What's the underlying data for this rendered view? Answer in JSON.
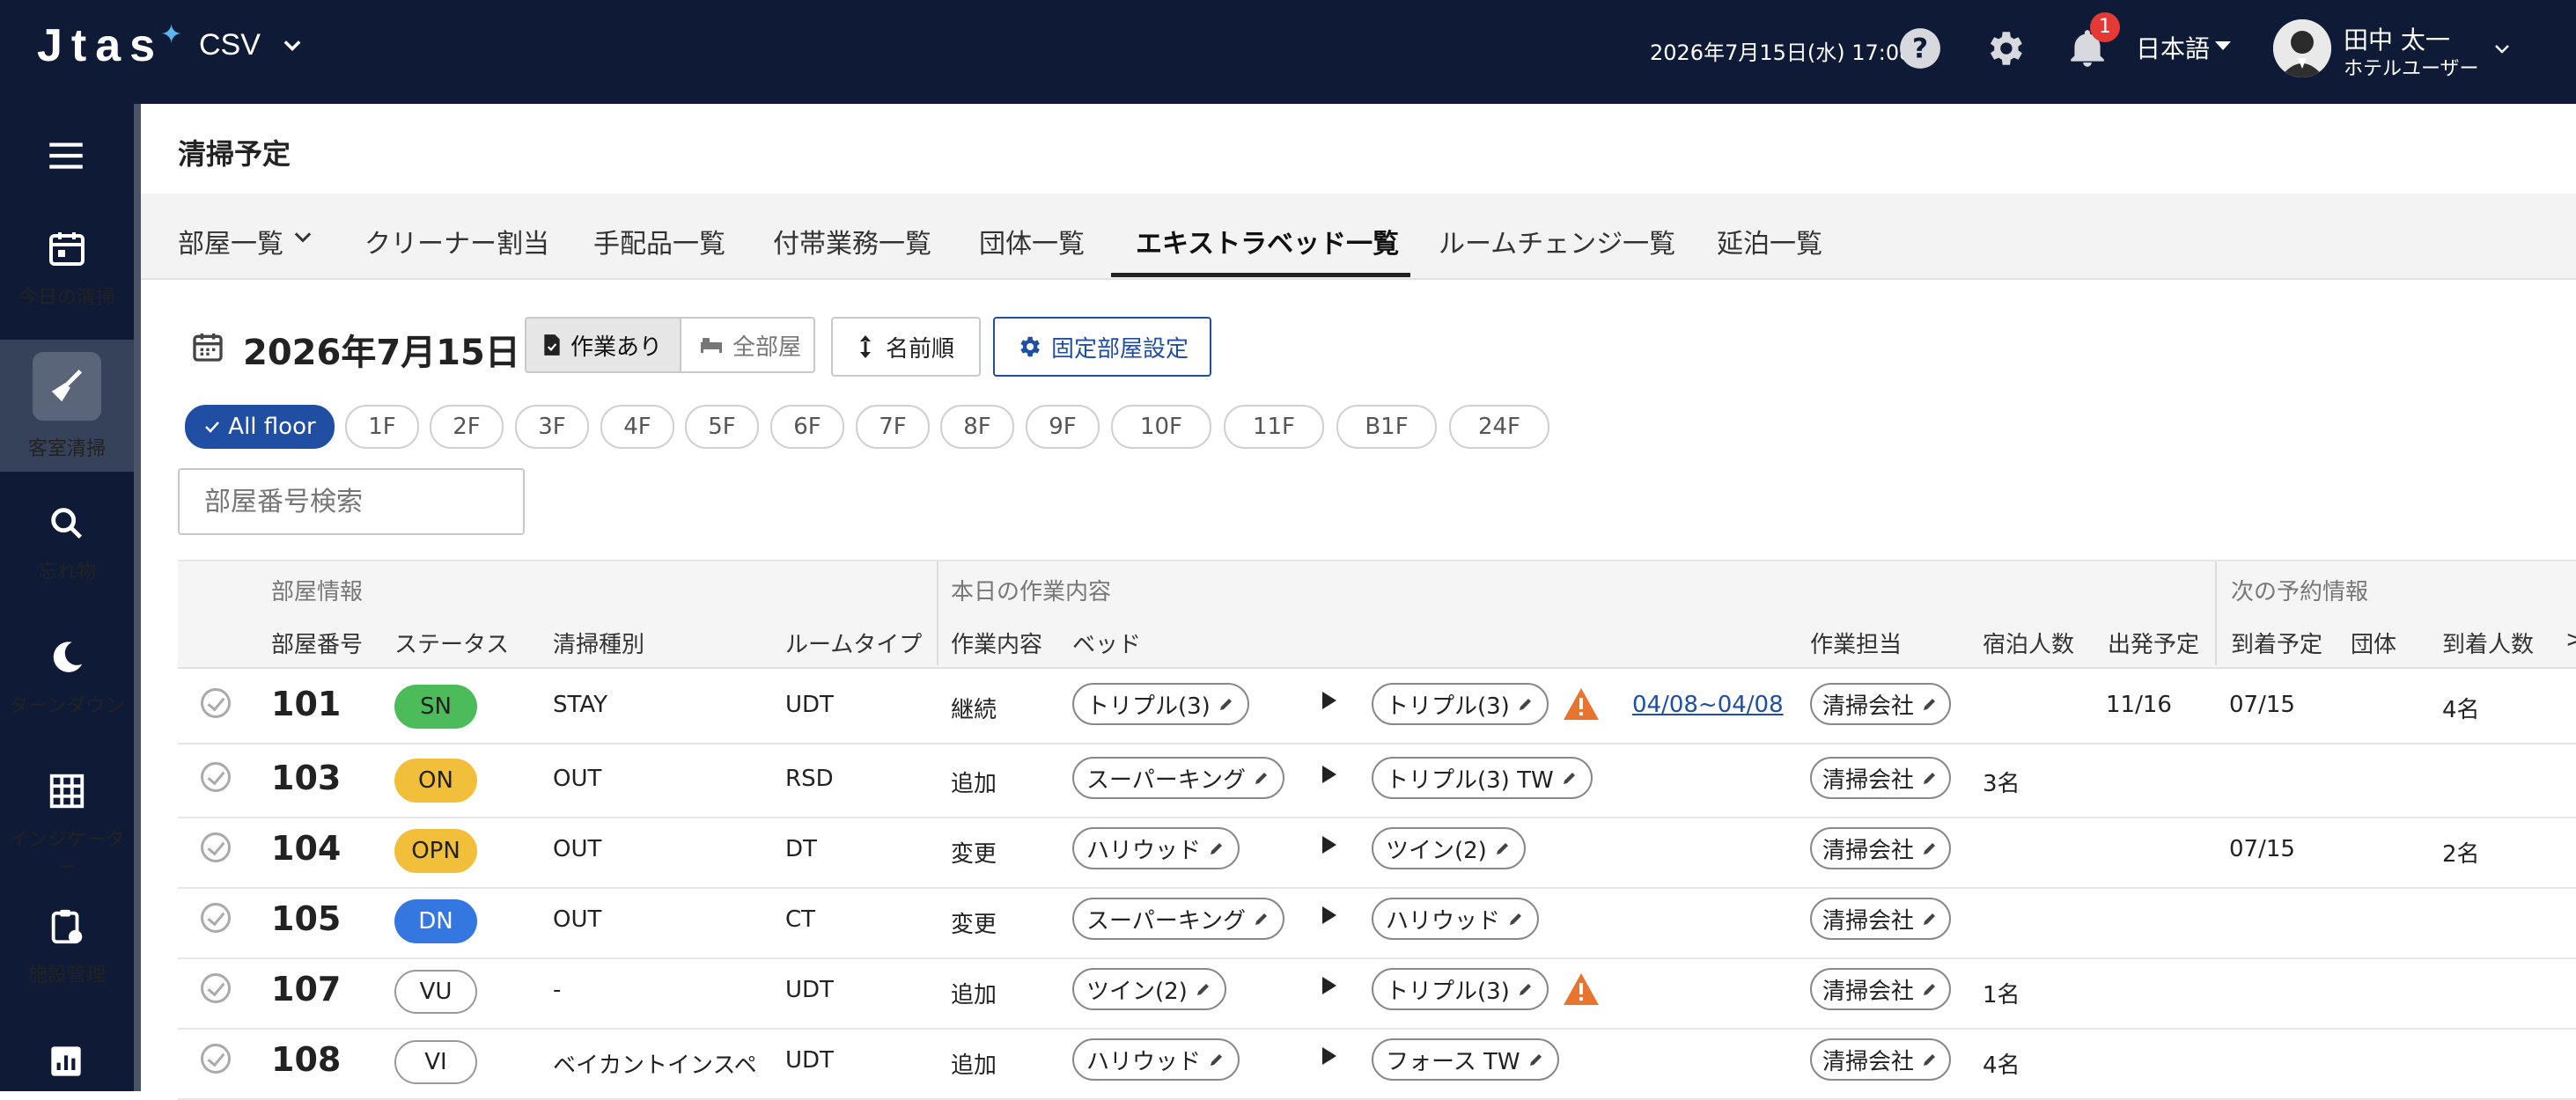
{
  "header": {
    "logo": "Jtas",
    "mode": "CSV",
    "datetime": "2026年7月15日(水) 17:08",
    "notification_count": "1",
    "language": "日本語",
    "user_name": "田中 太一",
    "user_role": "ホテルユーザー"
  },
  "sidebar": {
    "items": [
      {
        "label": "今日の清掃",
        "icon": "calendar-icon"
      },
      {
        "label": "客室清掃",
        "icon": "broom-icon"
      },
      {
        "label": "忘れ物",
        "icon": "search-icon"
      },
      {
        "label": "ターンダウン",
        "icon": "moon-icon"
      },
      {
        "label": "インジケーター",
        "icon": "grid-icon"
      },
      {
        "label": "施設管理",
        "icon": "clipboard-icon"
      }
    ]
  },
  "page": {
    "title": "清掃予定",
    "tabs": [
      "部屋一覧",
      "クリーナー割当",
      "手配品一覧",
      "付帯業務一覧",
      "団体一覧",
      "エキストラベッド一覧",
      "ルームチェンジ一覧",
      "延泊一覧"
    ],
    "active_tab": "エキストラベッド一覧"
  },
  "toolbar": {
    "date": "2026年7月15日",
    "work_label": "作業あり",
    "all_rooms_label": "全部屋",
    "sort_label": "名前順",
    "fixed_rooms_label": "固定部屋設定"
  },
  "floors": [
    "All floor",
    "1F",
    "2F",
    "3F",
    "4F",
    "5F",
    "6F",
    "7F",
    "8F",
    "9F",
    "10F",
    "11F",
    "B1F",
    "24F"
  ],
  "search": {
    "placeholder": "部屋番号検索"
  },
  "table": {
    "groups": {
      "room_info": "部屋情報",
      "today_work": "本日の作業内容",
      "next_booking": "次の予約情報"
    },
    "columns": {
      "room_no": "部屋番号",
      "status": "ステータス",
      "clean_type": "清掃種別",
      "room_type": "ルームタイプ",
      "work": "作業内容",
      "bed": "ベッド",
      "assignee": "作業担当",
      "guests": "宿泊人数",
      "departure": "出発予定",
      "arrival": "到着予定",
      "group": "団体",
      "arrival_guests": "到着人数",
      "more": ">"
    },
    "rows": [
      {
        "room": "101",
        "status": "SN",
        "status_color": "#4cbb5a",
        "clean": "STAY",
        "type": "UDT",
        "work": "継続",
        "bed_from": "トリプル(3)",
        "bed_to": "トリプル(3)",
        "warn": true,
        "period": "04/08~04/08",
        "assignee": "清掃会社",
        "guests": "",
        "departure": "11/16",
        "arrival": "07/15",
        "arrival_guests": "4名"
      },
      {
        "room": "103",
        "status": "ON",
        "status_color": "#f2bf3a",
        "clean": "OUT",
        "type": "RSD",
        "work": "追加",
        "bed_from": "スーパーキング",
        "bed_to": "トリプル(3) TW",
        "warn": false,
        "period": "",
        "assignee": "清掃会社",
        "guests": "3名",
        "departure": "",
        "arrival": "",
        "arrival_guests": ""
      },
      {
        "room": "104",
        "status": "OPN",
        "status_color": "#f2bf3a",
        "clean": "OUT",
        "type": "DT",
        "work": "変更",
        "bed_from": "ハリウッド",
        "bed_to": "ツイン(2)",
        "warn": false,
        "period": "",
        "assignee": "清掃会社",
        "guests": "",
        "departure": "",
        "arrival": "07/15",
        "arrival_guests": "2名"
      },
      {
        "room": "105",
        "status": "DN",
        "status_color": "#3577e0",
        "clean": "OUT",
        "type": "CT",
        "work": "変更",
        "bed_from": "スーパーキング",
        "bed_to": "ハリウッド",
        "warn": false,
        "period": "",
        "assignee": "清掃会社",
        "guests": "",
        "departure": "",
        "arrival": "",
        "arrival_guests": ""
      },
      {
        "room": "107",
        "status": "VU",
        "status_color": "#ffffff",
        "clean": "-",
        "type": "UDT",
        "work": "追加",
        "bed_from": "ツイン(2)",
        "bed_to": "トリプル(3)",
        "warn": true,
        "period": "",
        "assignee": "清掃会社",
        "guests": "1名",
        "departure": "",
        "arrival": "",
        "arrival_guests": ""
      },
      {
        "room": "108",
        "status": "VI",
        "status_color": "#ffffff",
        "clean": "ベイカントインスペ",
        "type": "UDT",
        "work": "追加",
        "bed_from": "ハリウッド",
        "bed_to": "フォース TW",
        "warn": false,
        "period": "",
        "assignee": "清掃会社",
        "guests": "4名",
        "departure": "",
        "arrival": "",
        "arrival_guests": ""
      }
    ]
  }
}
